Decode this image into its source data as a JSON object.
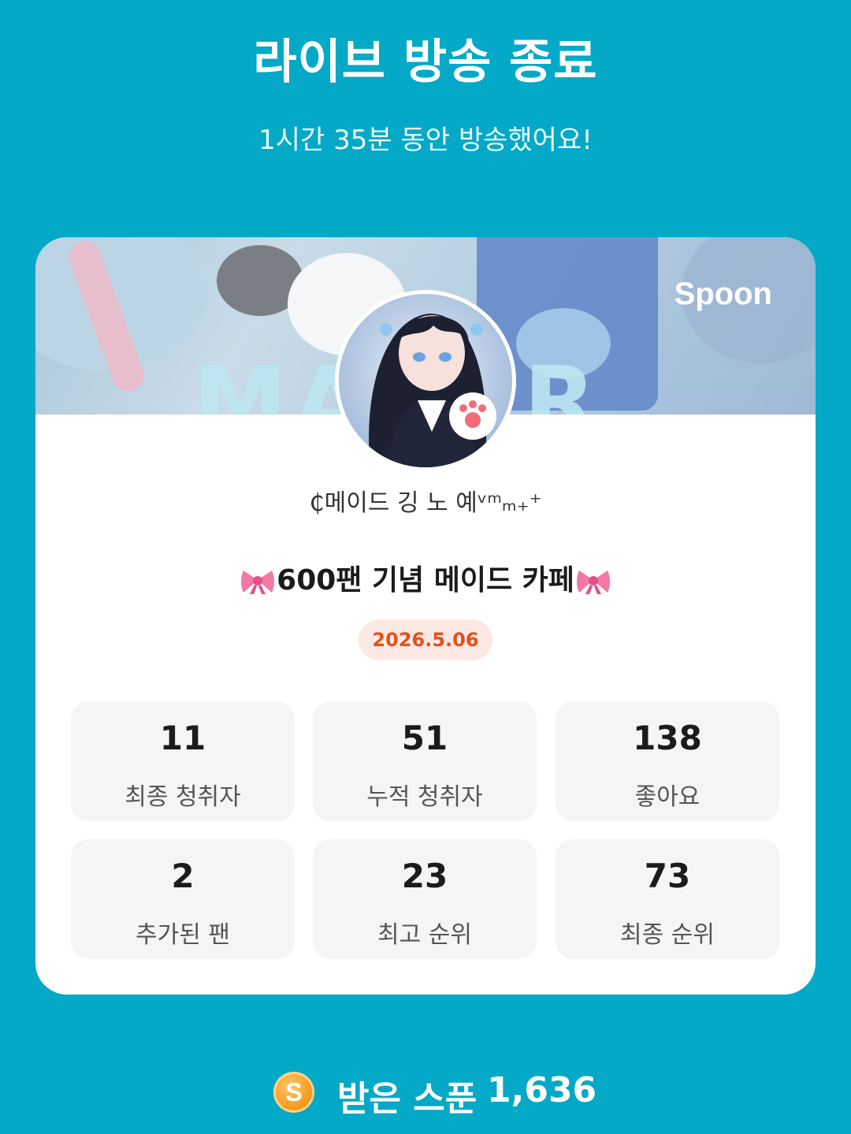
{
  "header": {
    "title": "라이브 방송 종료",
    "subtitle": "1시간 35분 동안 방송했어요!"
  },
  "card": {
    "banner_brand": "Spoon",
    "banner_art_text": "MAKER",
    "nickname": "₵메이드 깅 노 예ᵛᵐₘ₊⁺",
    "broadcast_title": "600팬 기념 메이드 카페",
    "date": "2026.5.06",
    "stats": [
      {
        "value": "11",
        "label": "최종 청취자"
      },
      {
        "value": "51",
        "label": "누적 청취자"
      },
      {
        "value": "138",
        "label": "좋아요"
      },
      {
        "value": "2",
        "label": "추가된 팬"
      },
      {
        "value": "23",
        "label": "최고 순위"
      },
      {
        "value": "73",
        "label": "최종 순위"
      }
    ]
  },
  "footer": {
    "coin_letter": "S",
    "received_label": "받은 스푼",
    "received_value": "1,636"
  },
  "colors": {
    "background": "#03a9c6",
    "card": "#ffffff",
    "stat_box": "#f5f5f5",
    "date_pill_bg": "#fde9e4",
    "date_pill_text": "#e5501b",
    "coin": "#f79a1e"
  },
  "icons": {
    "bow": "ribbon-bow-icon",
    "coin": "spoon-coin-icon"
  }
}
